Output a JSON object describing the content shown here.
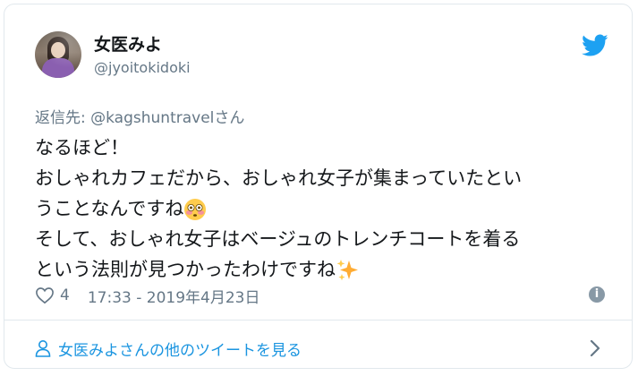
{
  "author": {
    "display_name": "女医みよ",
    "handle": "@jyoitokidoki"
  },
  "reply": {
    "prefix": "返信先: ",
    "mention": "@kagshuntravel",
    "suffix": "さん"
  },
  "tweet": {
    "line1": "なるほど！",
    "line2": "おしゃれカフェだから、おしゃれ女子が集まっていたとい",
    "line3": "うことなんですね",
    "line4": "そして、おしゃれ女子はベージュのトレンチコートを着る",
    "line5": "という法則が見つかったわけですね"
  },
  "meta": {
    "likes": "4",
    "timestamp": "17:33 - 2019年4月23日"
  },
  "footer": {
    "more_link": "女医みよさんの他のツイートを見る"
  },
  "colors": {
    "accent": "#1da1f2",
    "link": "#1b95e0",
    "secondary_text": "#657786",
    "border": "#e1e8ed"
  },
  "icons": {
    "brand": "twitter-bird-icon",
    "line3_emoji": "flushed-face-emoji",
    "line5_emoji": "sparkles-emoji",
    "like": "heart-outline-icon",
    "info": "info-icon",
    "profile": "person-icon",
    "more": "chevron-right-icon"
  }
}
